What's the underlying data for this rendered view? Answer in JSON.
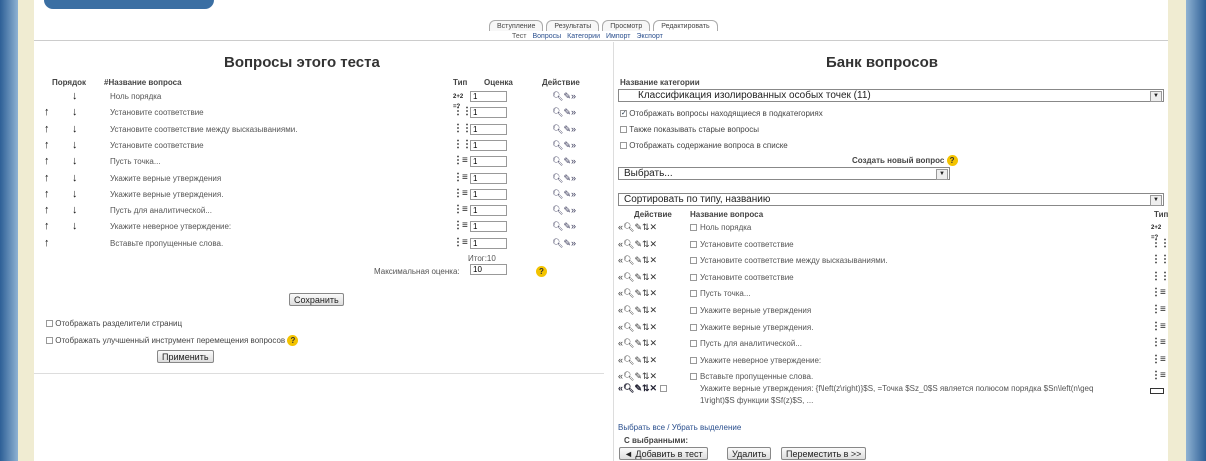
{
  "tabs": [
    "Вступление",
    "Результаты",
    "Просмотр",
    "Редактировать"
  ],
  "subtabs": [
    "Тест",
    "Вопросы",
    "Категории",
    "Импорт",
    "Экспорт"
  ],
  "left": {
    "title": "Вопросы этого теста",
    "headers": {
      "order": "Порядок",
      "name": "#Название вопроса",
      "type": "Тип",
      "grade": "Оценка",
      "action": "Действие"
    },
    "rows": [
      {
        "name": "Ноль порядка",
        "up": false,
        "down": true,
        "type": "calc",
        "grade": "1"
      },
      {
        "name": "Установите соответствие",
        "up": true,
        "down": true,
        "type": "match",
        "grade": "1"
      },
      {
        "name": "Установите соответствие между высказываниями.",
        "up": true,
        "down": true,
        "type": "match",
        "grade": "1"
      },
      {
        "name": "Установите соответствие",
        "up": true,
        "down": true,
        "type": "match",
        "grade": "1"
      },
      {
        "name": "Пусть точка...",
        "up": true,
        "down": true,
        "type": "multi",
        "grade": "1"
      },
      {
        "name": "Укажите верные утверждения",
        "up": true,
        "down": true,
        "type": "multi",
        "grade": "1"
      },
      {
        "name": "Укажите верные утверждения.",
        "up": true,
        "down": true,
        "type": "multi",
        "grade": "1"
      },
      {
        "name": "Пусть для аналитической...",
        "up": true,
        "down": true,
        "type": "multi",
        "grade": "1"
      },
      {
        "name": "Укажите неверное утверждение:",
        "up": true,
        "down": true,
        "type": "multi",
        "grade": "1"
      },
      {
        "name": "Вставьте пропущенные слова.",
        "up": true,
        "down": false,
        "type": "multi",
        "grade": "1"
      }
    ],
    "total_label": "Итог:10",
    "max_grade_label": "Максимальная оценка:",
    "max_grade_value": "10",
    "save_button": "Сохранить",
    "show_page_breaks": "Отображать разделители страниц",
    "show_reorder_tool": "Отображать улучшенный инструмент перемещения вопросов",
    "apply_button": "Применить"
  },
  "right": {
    "title": "Банк вопросов",
    "category_label": "Название категории",
    "category_value": "Классификация изолированных особых точек (11)",
    "opt_subcategories": "Отображать вопросы находящиеся в подкатегориях",
    "opt_old": "Также показывать старые вопросы",
    "opt_content": "Отображать содержание вопроса в списке",
    "create_new_label": "Создать новый вопрос",
    "create_select": "Выбрать...",
    "sort_select": "Сортировать по типу, названию",
    "headers": {
      "action": "Действие",
      "name": "Название вопроса",
      "type": "Тип"
    },
    "rows": [
      {
        "name": "Ноль порядка",
        "type": "calc"
      },
      {
        "name": "Установите соответствие",
        "type": "match"
      },
      {
        "name": "Установите соответствие между высказываниями.",
        "type": "match"
      },
      {
        "name": "Установите соответствие",
        "type": "match"
      },
      {
        "name": "Пусть точка...",
        "type": "multi"
      },
      {
        "name": "Укажите верные утверждения",
        "type": "multi"
      },
      {
        "name": "Укажите верные утверждения.",
        "type": "multi"
      },
      {
        "name": "Пусть для аналитической...",
        "type": "multi"
      },
      {
        "name": "Укажите неверное утверждение:",
        "type": "multi"
      },
      {
        "name": "Вставьте пропущенные слова.",
        "type": "multi"
      }
    ],
    "long_row_line1": "Укажите верные утверждения: {f\\left(z\\right)}$S, =Точка $Sz_0$S является полюсом порядка $Sn\\left(n\\geq",
    "long_row_line2": "1\\right)$S функции $Sf(z)$S, ...",
    "select_all": "Выбрать все / Убрать выделение",
    "with_selected": "С выбранными:",
    "add_button": "◄ Добавить в тест",
    "delete_button": "Удалить",
    "move_button": "Переместить в >>"
  },
  "icons": {
    "up": "up-arrow-icon",
    "down": "down-arrow-icon",
    "preview": "preview-icon",
    "edit": "edit-icon",
    "move_right": "move-right-icon",
    "add_left": "add-to-quiz-icon",
    "move": "move-icon",
    "delete": "delete-icon",
    "help": "help-icon"
  }
}
